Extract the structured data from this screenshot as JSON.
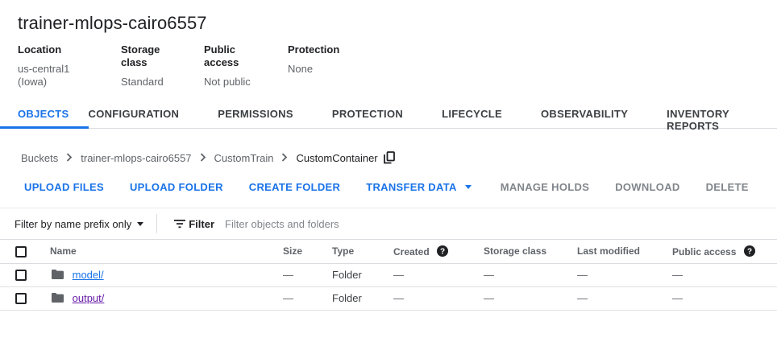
{
  "bucket": {
    "name": "trainer-mlops-cairo6557",
    "meta": [
      {
        "label": "Location",
        "value": "us-central1 (Iowa)"
      },
      {
        "label": "Storage class",
        "value": "Standard"
      },
      {
        "label": "Public access",
        "value": "Not public"
      },
      {
        "label": "Protection",
        "value": "None"
      }
    ]
  },
  "tabs": [
    {
      "label": "OBJECTS",
      "active": true
    },
    {
      "label": "CONFIGURATION"
    },
    {
      "label": "PERMISSIONS"
    },
    {
      "label": "PROTECTION"
    },
    {
      "label": "LIFECYCLE"
    },
    {
      "label": "OBSERVABILITY"
    },
    {
      "label": "INVENTORY REPORTS"
    }
  ],
  "breadcrumb": [
    "Buckets",
    "trainer-mlops-cairo6557",
    "CustomTrain",
    "CustomContainer"
  ],
  "actions": {
    "upload_files": "UPLOAD FILES",
    "upload_folder": "UPLOAD FOLDER",
    "create_folder": "CREATE FOLDER",
    "transfer_data": "TRANSFER DATA",
    "manage_holds": "MANAGE HOLDS",
    "download": "DOWNLOAD",
    "delete": "DELETE"
  },
  "filter": {
    "mode": "Filter by name prefix only",
    "button": "Filter",
    "placeholder": "Filter objects and folders"
  },
  "table": {
    "columns": {
      "name": "Name",
      "size": "Size",
      "type": "Type",
      "created": "Created",
      "storage_class": "Storage class",
      "last_modified": "Last modified",
      "public_access": "Public access"
    },
    "rows": [
      {
        "name": "model/",
        "size": "—",
        "type": "Folder",
        "created": "—",
        "storage_class": "—",
        "last_modified": "—",
        "public_access": "—"
      },
      {
        "name": "output/",
        "size": "—",
        "type": "Folder",
        "created": "—",
        "storage_class": "—",
        "last_modified": "—",
        "public_access": "—"
      }
    ]
  },
  "colors": {
    "accent": "#1a73e8",
    "visited_link": "#681da8",
    "disabled": "#80868b",
    "divider": "#dadce0"
  },
  "icons": {
    "copy": "copy-icon",
    "help": "help-icon",
    "folder": "folder-icon",
    "filter": "filter-icon",
    "chevron": "chevron-right-icon",
    "dropdown": "caret-down-icon"
  }
}
